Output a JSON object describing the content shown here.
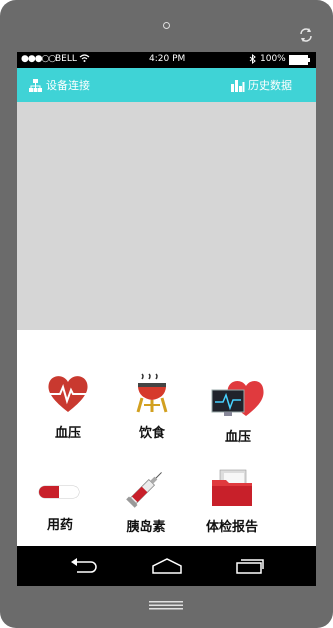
{
  "status": {
    "signal": "●●●○○",
    "carrier": "BELL",
    "time": "4:20 PM",
    "battery": "100%",
    "bluetooth_icon": "bluetooth-icon"
  },
  "appbar": {
    "device_connect": "设备连接",
    "history": "历史数据",
    "accent": "#3fd3d6"
  },
  "features": [
    {
      "label": "血压",
      "icon": "heart-pulse-icon"
    },
    {
      "label": "饮食",
      "icon": "grill-icon"
    },
    {
      "label": "血压",
      "icon": "heart-monitor-icon"
    },
    {
      "label": "用药",
      "icon": "capsule-icon"
    },
    {
      "label": "胰岛素",
      "icon": "syringe-icon"
    },
    {
      "label": "体检报告",
      "icon": "report-folder-icon"
    }
  ]
}
